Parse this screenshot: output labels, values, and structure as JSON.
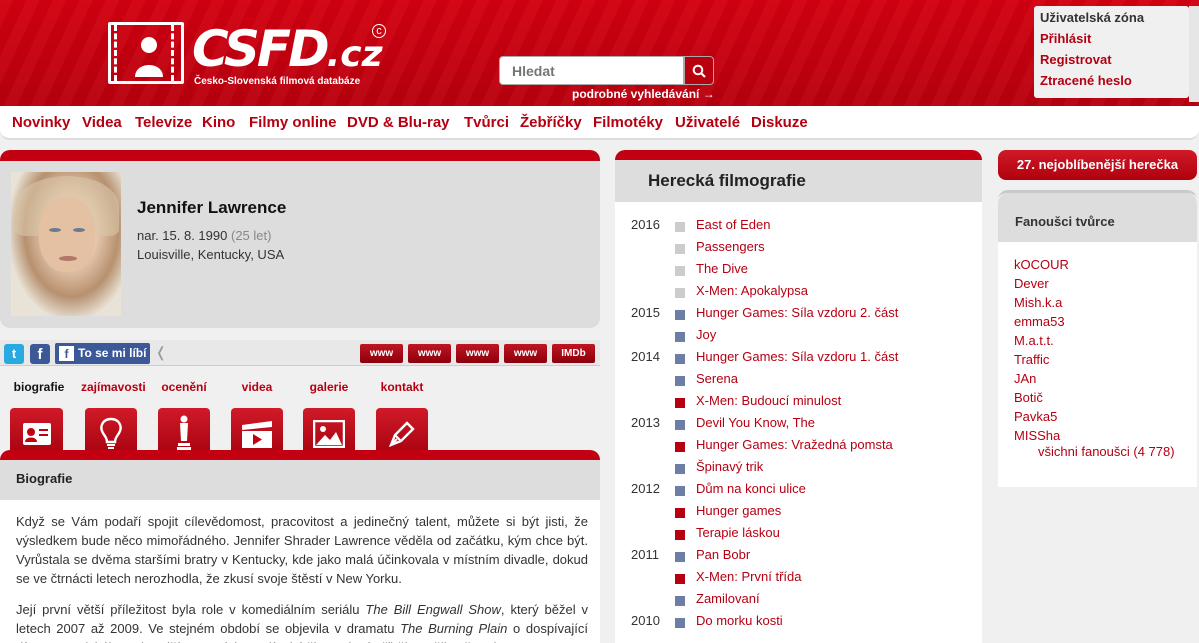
{
  "header": {
    "logo_text": "CSFD",
    "logo_tld": ".cz",
    "logo_subtitle": "Česko-Slovenská filmová databáze",
    "search_placeholder": "Hledat",
    "advanced_search": "podrobné vyhledávání →",
    "user_zone": {
      "title": "Uživatelská zóna",
      "login": "Přihlásit",
      "register": "Registrovat",
      "lost_password": "Ztracené heslo"
    }
  },
  "nav": [
    "Novinky",
    "Videa",
    "Televize",
    "Kino",
    "Filmy online",
    "DVD & Blu-ray",
    "Tvůrci",
    "Žebříčky",
    "Filmotéky",
    "Uživatelé",
    "Diskuze"
  ],
  "profile": {
    "name": "Jennifer Lawrence",
    "born": "nar. 15. 8. 1990",
    "age": "(25 let)",
    "place": "Louisville, Kentucky, USA"
  },
  "social": {
    "like_label": "To se mi líbí",
    "links": [
      "www",
      "www",
      "www",
      "www",
      "IMDb"
    ]
  },
  "tabs": [
    {
      "label": "biografie",
      "icon": "id-card-icon",
      "active": true
    },
    {
      "label": "zajímavosti",
      "icon": "lightbulb-icon"
    },
    {
      "label": "ocenění",
      "icon": "oscar-icon"
    },
    {
      "label": "videa",
      "icon": "video-icon"
    },
    {
      "label": "galerie",
      "icon": "gallery-icon"
    },
    {
      "label": "kontakt",
      "icon": "pen-icon"
    }
  ],
  "bio": {
    "title": "Biografie",
    "p1": "Když se Vám podaří spojit cílevědomost, pracovitost a jedinečný talent, můžete si být jisti, že výsledkem bude něco mimořádného. Jennifer Shrader Lawrence věděla od začátku, kým chce být. Vyrůstala se dvěma staršími bratry v Kentucky, kde jako malá účinkovala v místním divadle, dokud se ve čtrnácti letech nerozhodla, že zkusí svoje štěstí v New Yorku.",
    "p2_a": "Její první větší příležitost byla role v komediálním seriálu ",
    "p2_show": "The Bill Engwall Show",
    "p2_b": ", který běžel v letech 2007 až 2009. Ve stejném období se objevila v dramatu ",
    "p2_film": "The Burning Plain",
    "p2_c": " o dospívající dívce z mexického pohraničí. Za zmínku stojí také životopisný příběh umělkyně Lori Petty ve"
  },
  "filmography": {
    "title": "Herecká filmografie",
    "rows": [
      {
        "year": "2016",
        "title": "East of Eden",
        "rating": "none"
      },
      {
        "year": "",
        "title": "Passengers",
        "rating": "none"
      },
      {
        "year": "",
        "title": "The Dive",
        "rating": "none"
      },
      {
        "year": "",
        "title": "X-Men: Apokalypsa",
        "rating": "none"
      },
      {
        "year": "2015",
        "title": "Hunger Games: Síla vzdoru 2. část",
        "rating": "average"
      },
      {
        "year": "",
        "title": "Joy",
        "rating": "average"
      },
      {
        "year": "2014",
        "title": "Hunger Games: Síla vzdoru 1. část",
        "rating": "average"
      },
      {
        "year": "",
        "title": "Serena",
        "rating": "average"
      },
      {
        "year": "",
        "title": "X-Men: Budoucí minulost",
        "rating": "good"
      },
      {
        "year": "2013",
        "title": "Devil You Know, The",
        "rating": "average"
      },
      {
        "year": "",
        "title": "Hunger Games: Vražedná pomsta",
        "rating": "good"
      },
      {
        "year": "",
        "title": "Špinavý trik",
        "rating": "average"
      },
      {
        "year": "2012",
        "title": "Dům na konci ulice",
        "rating": "average"
      },
      {
        "year": "",
        "title": "Hunger games",
        "rating": "good"
      },
      {
        "year": "",
        "title": "Terapie láskou",
        "rating": "good"
      },
      {
        "year": "2011",
        "title": "Pan Bobr",
        "rating": "average"
      },
      {
        "year": "",
        "title": "X-Men: První třída",
        "rating": "good"
      },
      {
        "year": "",
        "title": "Zamilovaní",
        "rating": "average"
      },
      {
        "year": "2010",
        "title": "Do morku kosti",
        "rating": "average"
      }
    ]
  },
  "rating_colors": {
    "none": "#cccccc",
    "average": "#6d7ea6",
    "good": "#b50012"
  },
  "rank": "27. nejoblíbenější herečka",
  "fans": {
    "title": "Fanoušci tvůrce",
    "list": [
      "kOCOUR",
      "Dever",
      "Mish.k.a",
      "emma53",
      "M.a.t.t.",
      "Traffic",
      "JAn",
      "Botič",
      "Pavka5",
      "MISSha"
    ],
    "all": "všichni fanoušci (4 778)"
  }
}
